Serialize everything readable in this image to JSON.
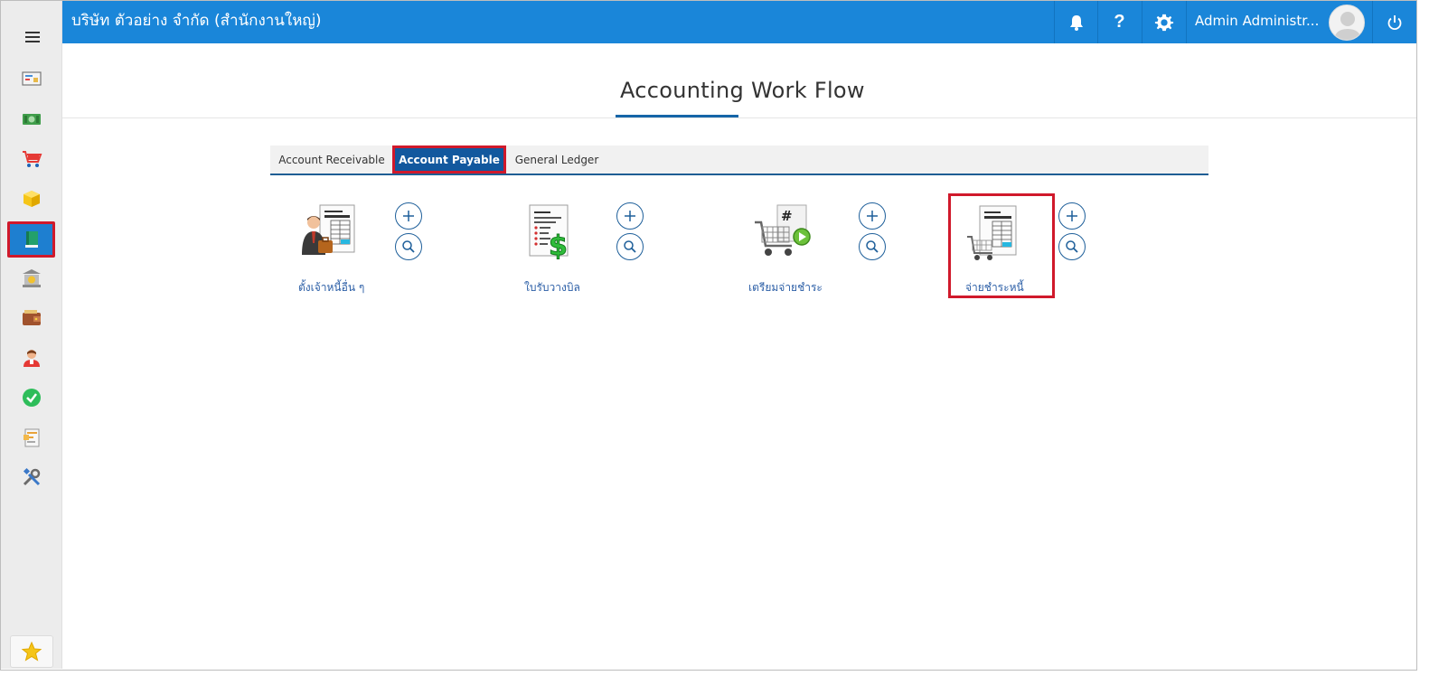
{
  "header": {
    "company": "บริษัท ตัวอย่าง จำกัด (สำนักงานใหญ่)",
    "user_name": "Admin Administr...",
    "icons": [
      "bell-icon",
      "help-icon",
      "gear-icon",
      "avatar",
      "power-icon"
    ]
  },
  "sidebar": {
    "items": [
      {
        "name": "dashboard",
        "icon": "monitor-icon"
      },
      {
        "name": "finance",
        "icon": "money-icon"
      },
      {
        "name": "sales",
        "icon": "cart-icon"
      },
      {
        "name": "inventory",
        "icon": "box-icon"
      },
      {
        "name": "accounting",
        "icon": "book-icon",
        "active": true
      },
      {
        "name": "bank",
        "icon": "bank-icon"
      },
      {
        "name": "wallet",
        "icon": "wallet-icon"
      },
      {
        "name": "hr",
        "icon": "person-icon"
      },
      {
        "name": "approval",
        "icon": "check-icon"
      },
      {
        "name": "report",
        "icon": "report-icon"
      },
      {
        "name": "settings",
        "icon": "tools-icon"
      }
    ],
    "favorite_icon": "star-icon"
  },
  "page": {
    "title": "Accounting Work Flow"
  },
  "tabs": [
    {
      "label": "Account Receivable",
      "active": false
    },
    {
      "label": "Account Payable",
      "active": true
    },
    {
      "label": "General Ledger",
      "active": false
    }
  ],
  "workflow": [
    {
      "label": "ตั้งเจ้าหนี้อื่น ๆ",
      "icon": "businessman-invoice-icon"
    },
    {
      "label": "ใบรับวางบิล",
      "icon": "bill-dollar-icon"
    },
    {
      "label": "เตรียมจ่ายชำระ",
      "icon": "cart-play-icon"
    },
    {
      "label": "จ่ายชำระหนี้",
      "icon": "cart-document-icon",
      "highlighted": true
    }
  ],
  "colors": {
    "topbar": "#1a86d9",
    "active_tab": "#12589e",
    "highlight": "#d0192b",
    "link": "#2b5ea6"
  }
}
